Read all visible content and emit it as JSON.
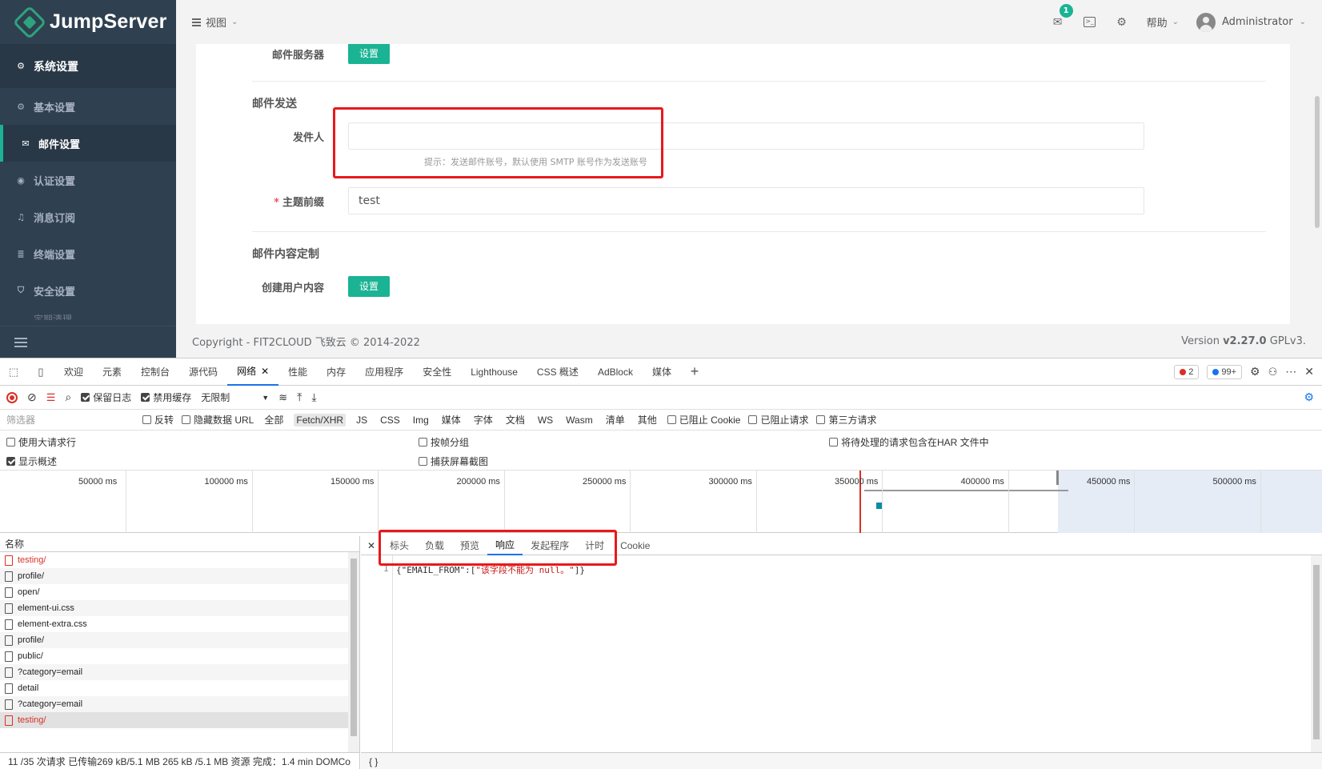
{
  "app": {
    "logo_text": "JumpServer",
    "colors": {
      "sidebar": "#2f4050",
      "accent": "#1ab394",
      "highlight": "#e8191b"
    }
  },
  "sidebar": {
    "header": {
      "icon": "gear-icon",
      "label": "系统设置"
    },
    "items": [
      {
        "icon": "gear-icon",
        "label": "基本设置"
      },
      {
        "icon": "envelope-icon",
        "label": "邮件设置",
        "active": true
      },
      {
        "icon": "user-circle-icon",
        "label": "认证设置"
      },
      {
        "icon": "bell-icon",
        "label": "消息订阅"
      },
      {
        "icon": "server-icon",
        "label": "终端设置"
      },
      {
        "icon": "shield-icon",
        "label": "安全设置"
      }
    ],
    "cutoff_label": "定期清理"
  },
  "topbar": {
    "view_label": "视图",
    "mail_badge": "1",
    "help_label": "帮助",
    "user_name": "Administrator"
  },
  "form": {
    "mail_server_label": "邮件服务器",
    "mail_server_button": "设置",
    "section_send": "邮件发送",
    "sender_label": "发件人",
    "sender_value": "",
    "sender_hint": "提示：发送邮件账号，默认使用 SMTP 账号作为发送账号",
    "subject_prefix_label": "主题前缀",
    "subject_prefix_value": "test",
    "section_content": "邮件内容定制",
    "create_user_label": "创建用户内容",
    "create_user_button": "设置"
  },
  "footer": {
    "copyright": "Copyright - FIT2CLOUD 飞致云 © 2014-2022",
    "version_prefix": "Version ",
    "version": "v2.27.0",
    "license": " GPLv3."
  },
  "devtools": {
    "tabs": [
      "欢迎",
      "元素",
      "控制台",
      "源代码",
      "网络",
      "性能",
      "内存",
      "应用程序",
      "安全性",
      "Lighthouse",
      "CSS 概述",
      "AdBlock",
      "媒体"
    ],
    "active_tab": "网络",
    "error_count": "2",
    "message_count": "99+",
    "toolbar": {
      "preserve_log": "保留日志",
      "disable_cache": "禁用缓存",
      "throttle": "无限制"
    },
    "filter": {
      "placeholder": "筛选器",
      "invert": "反转",
      "hide_data_url": "隐藏数据 URL",
      "types": [
        "全部",
        "Fetch/XHR",
        "JS",
        "CSS",
        "Img",
        "媒体",
        "字体",
        "文档",
        "WS",
        "Wasm",
        "清单",
        "其他"
      ],
      "active_type": "Fetch/XHR",
      "blocked_cookie": "已阻止 Cookie",
      "blocked_requests": "已阻止请求",
      "third_party": "第三方请求"
    },
    "options": {
      "big_rows": "使用大请求行",
      "group_by_frame": "按帧分组",
      "har_sensitive": "将待处理的请求包含在HAR 文件中",
      "overview": "显示概述",
      "screenshots": "捕获屏幕截图"
    },
    "timeline_ticks": [
      "50000 ms",
      "100000 ms",
      "150000 ms",
      "200000 ms",
      "250000 ms",
      "300000 ms",
      "350000 ms",
      "400000 ms",
      "450000 ms",
      "500000 ms"
    ],
    "list_header": "名称",
    "requests": [
      {
        "name": "testing/",
        "error": true
      },
      {
        "name": "profile/",
        "error": false
      },
      {
        "name": "open/",
        "error": false
      },
      {
        "name": "element-ui.css",
        "error": false
      },
      {
        "name": "element-extra.css",
        "error": false
      },
      {
        "name": "profile/",
        "error": false
      },
      {
        "name": "public/",
        "error": false
      },
      {
        "name": "?category=email",
        "error": false
      },
      {
        "name": "detail",
        "error": false
      },
      {
        "name": "?category=email",
        "error": false
      },
      {
        "name": "testing/",
        "error": true,
        "selected": true
      }
    ],
    "status_bar": "11 /35 次请求  已传输269 kB/5.1 MB  265 kB /5.1 MB 资源  完成：1.4 min  DOMCo",
    "detail_tabs": [
      "标头",
      "负载",
      "预览",
      "响应",
      "发起程序",
      "计时",
      "Cookie"
    ],
    "active_detail_tab": "响应",
    "response": {
      "line_number": "1",
      "prefix": "{\"EMAIL_FROM\":[",
      "string": "\"该字段不能为 null。\"",
      "suffix": "]}"
    },
    "detail_status": "{ }"
  }
}
